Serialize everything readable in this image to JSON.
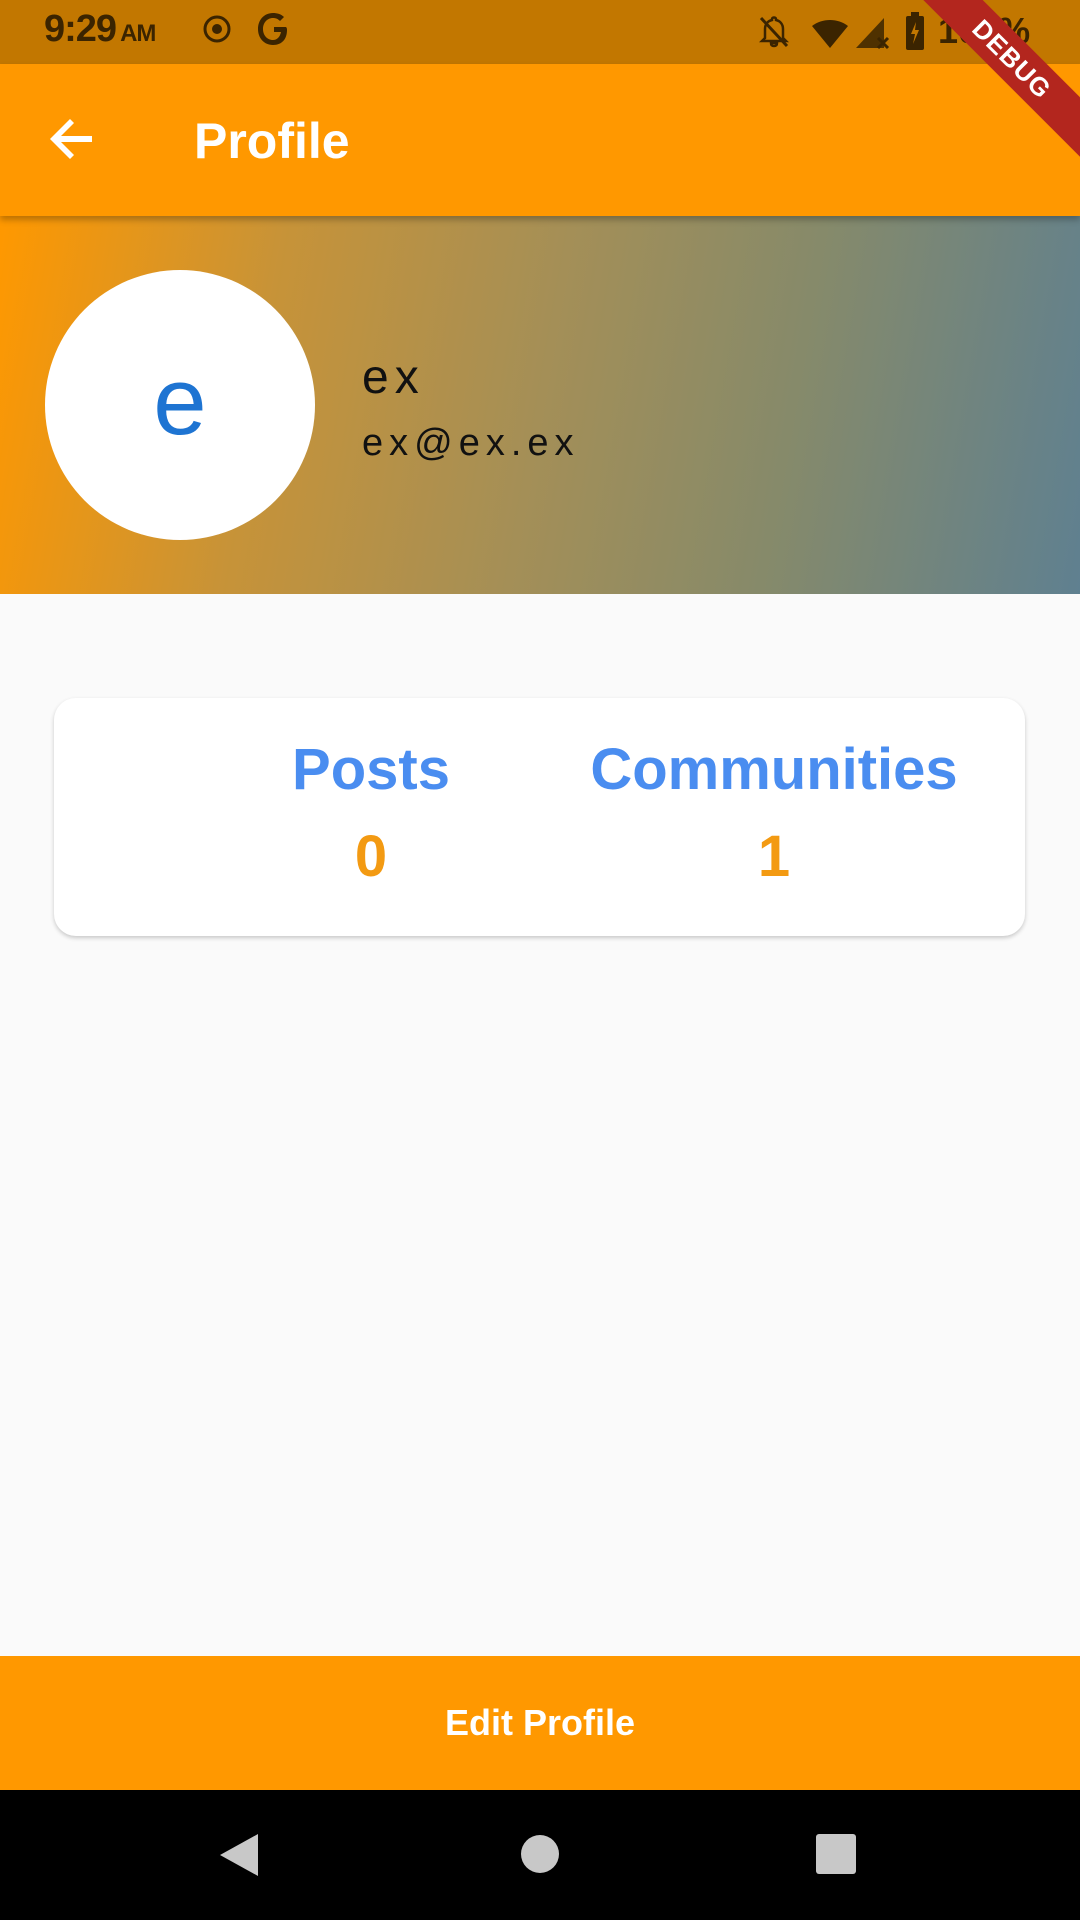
{
  "status_bar": {
    "time": "9:29",
    "ampm": "AM",
    "battery": "100%"
  },
  "app_bar": {
    "title": "Profile"
  },
  "debug_banner": "DEBUG",
  "profile": {
    "avatar_letter": "e",
    "username": "ex",
    "email": "ex@ex.ex"
  },
  "stats": {
    "posts_label": "Posts",
    "posts_value": "0",
    "communities_label": "Communities",
    "communities_value": "1"
  },
  "edit_button_label": "Edit Profile",
  "colors": {
    "primary": "#ff9800",
    "status_bar": "#c27700",
    "stat_label": "#4a8df0",
    "stat_value": "#f39a12",
    "avatar_letter": "#1e74d2"
  }
}
